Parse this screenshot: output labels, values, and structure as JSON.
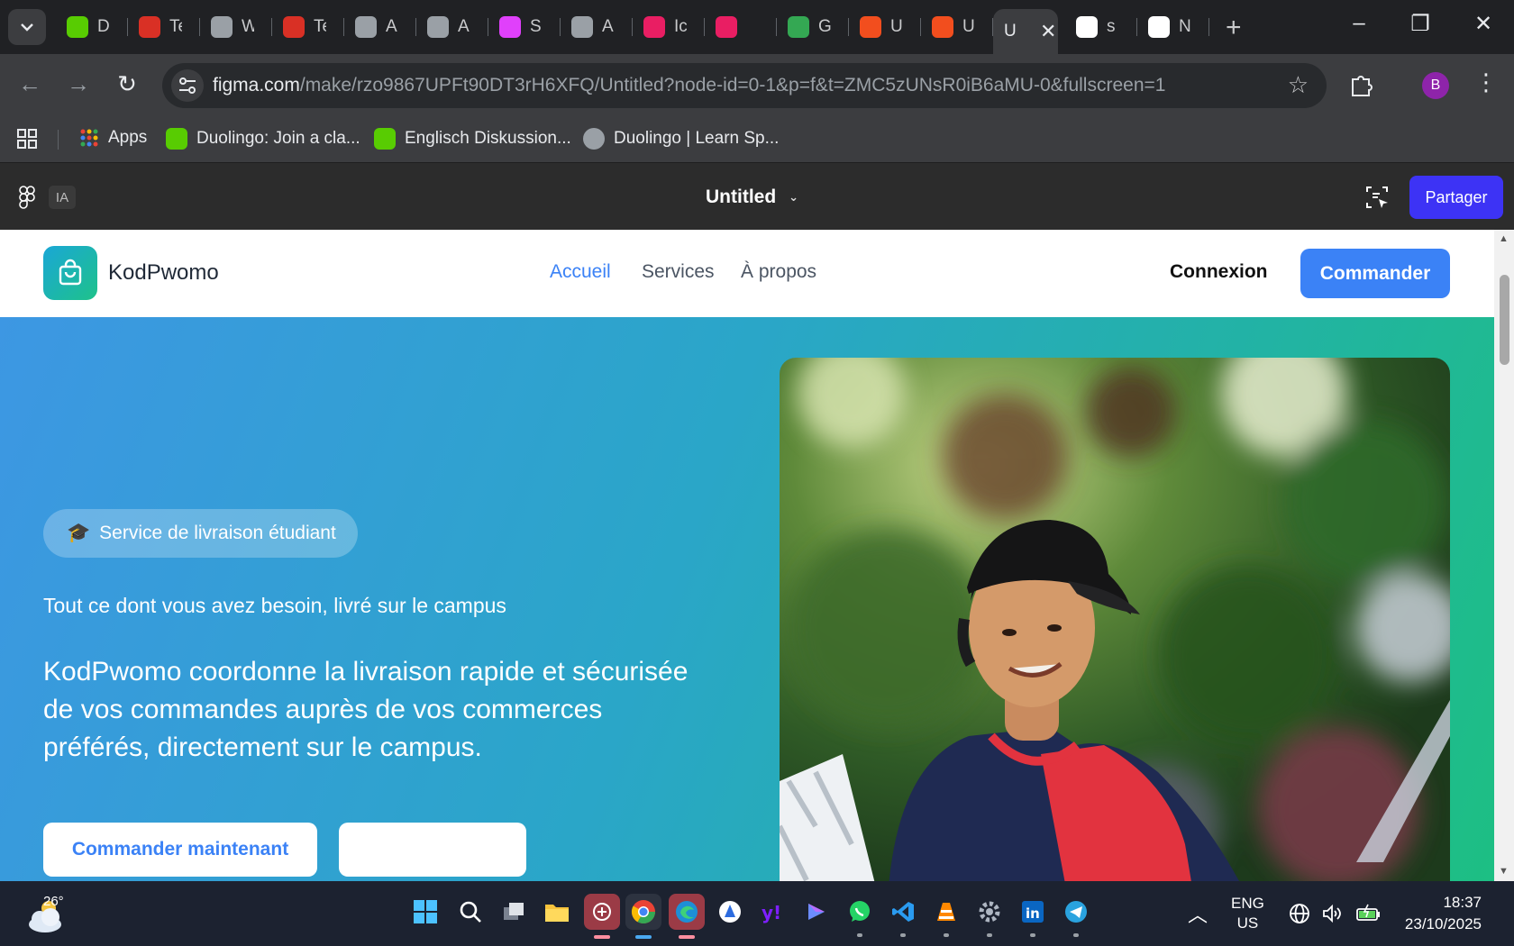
{
  "browser": {
    "tabs": [
      {
        "label": "D",
        "color": "#58cc02"
      },
      {
        "label": "Te",
        "color": "#d93025"
      },
      {
        "label": "W",
        "color": "#9aa0a6"
      },
      {
        "label": "Te",
        "color": "#d93025"
      },
      {
        "label": "A",
        "color": "#9aa0a6"
      },
      {
        "label": "A",
        "color": "#9aa0a6"
      },
      {
        "label": "S",
        "color": "#e040fb"
      },
      {
        "label": "A",
        "color": "#9aa0a6"
      },
      {
        "label": "Ic",
        "color": "#e91e63"
      },
      {
        "label": "",
        "color": "#e91e63"
      },
      {
        "label": "G",
        "color": "#34a853"
      },
      {
        "label": "U",
        "color": "#f24e1e"
      },
      {
        "label": "U",
        "color": "#f24e1e"
      },
      {
        "label": "U",
        "color": "#9aa0a6"
      },
      {
        "label": "s",
        "color": "#ffffff"
      },
      {
        "label": "N",
        "color": "#ffffff"
      }
    ],
    "active_tab_index": 13,
    "url_host": "figma.com",
    "url_path": "/make/rzo9867UPFt90DT3rH6XFQ/Untitled?node-id=0-1&p=f&t=ZMC5zUNsR0iB6aMU-0&fullscreen=1",
    "profile_initial": "B",
    "bookmarks": [
      {
        "label": "Apps"
      },
      {
        "label": "Duolingo: Join a cla..."
      },
      {
        "label": "Englisch Diskussion..."
      },
      {
        "label": "Duolingo | Learn Sp..."
      }
    ]
  },
  "figma": {
    "ia_label": "IA",
    "file_title": "Untitled",
    "share_label": "Partager"
  },
  "site": {
    "brand": "KodPwomo",
    "nav": [
      "Accueil",
      "Services",
      "À propos"
    ],
    "login_label": "Connexion",
    "order_label": "Commander",
    "badge_emoji": "🎓",
    "badge_label": "Service de livraison étudiant",
    "sub_headline": "Tout ce dont vous avez besoin, livré sur le campus",
    "lead": "KodPwomo coordonne la livraison rapide et sécurisée de vos commandes auprès de vos commerces préférés, directement sur le campus.",
    "cta_primary": "Commander maintenant",
    "cta_secondary": "",
    "accent_color": "#3b82f6"
  },
  "taskbar": {
    "temperature": "26°",
    "lang_line1": "ENG",
    "lang_line2": "US",
    "time": "18:37",
    "date": "23/10/2025"
  }
}
